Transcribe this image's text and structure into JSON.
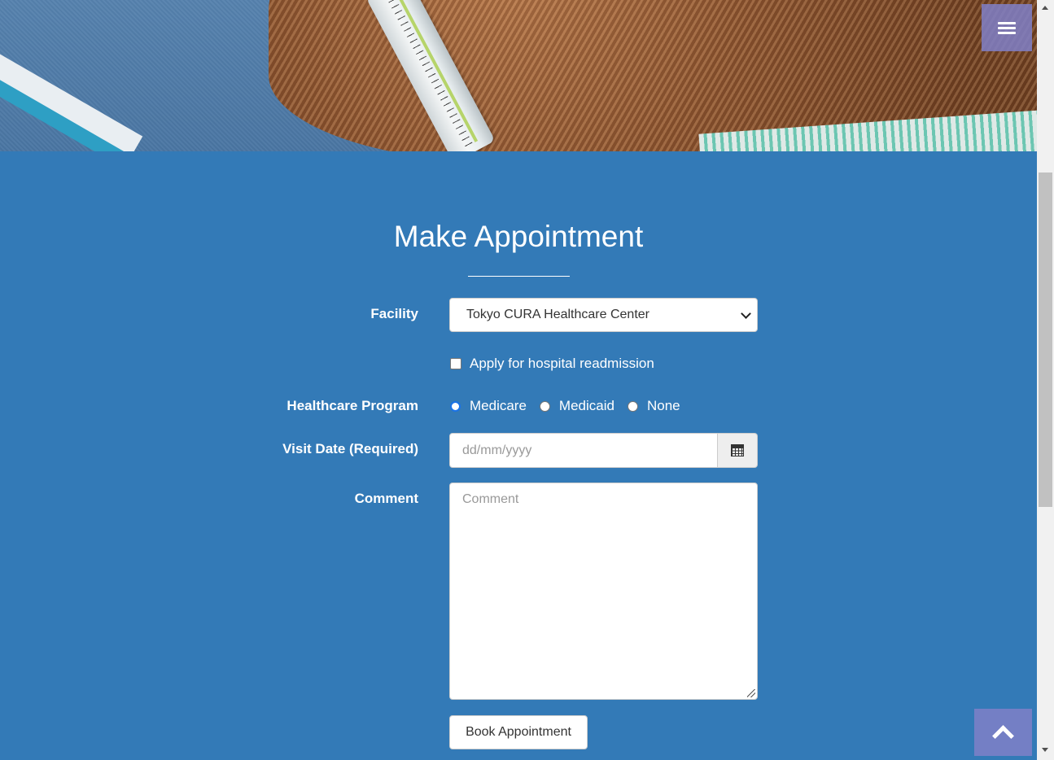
{
  "header": {
    "menu_icon": "bars-icon"
  },
  "form": {
    "title": "Make Appointment",
    "facility": {
      "label": "Facility",
      "selected": "Tokyo CURA Healthcare Center"
    },
    "readmission": {
      "label": "Apply for hospital readmission",
      "checked": false
    },
    "program": {
      "label": "Healthcare Program",
      "options": [
        "Medicare",
        "Medicaid",
        "None"
      ]
    },
    "visit_date": {
      "label": "Visit Date (Required)",
      "placeholder": "dd/mm/yyyy"
    },
    "comment": {
      "label": "Comment",
      "placeholder": "Comment"
    },
    "submit_label": "Book Appointment"
  },
  "colors": {
    "section_bg": "#337ab7",
    "overlay_button": "#8080c8"
  }
}
